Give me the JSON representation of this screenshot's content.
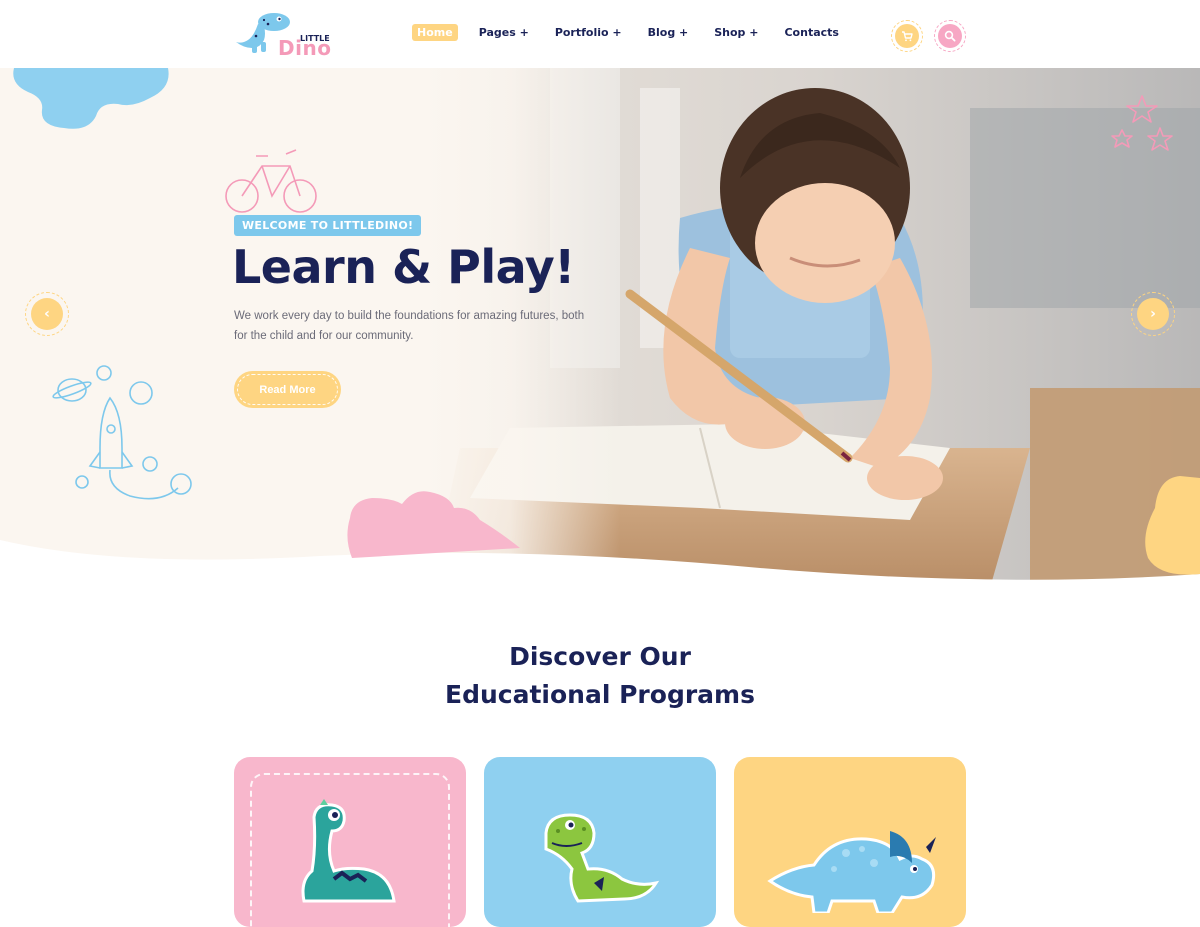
{
  "brand": {
    "logo_small": "LITTLE",
    "logo_big": "Dino"
  },
  "nav": {
    "items": [
      {
        "label": "Home",
        "active": true
      },
      {
        "label": "Pages +"
      },
      {
        "label": "Portfolio +"
      },
      {
        "label": "Blog +"
      },
      {
        "label": "Shop +"
      },
      {
        "label": "Contacts"
      }
    ],
    "cart_icon": "cart-icon",
    "search_icon": "search-icon"
  },
  "hero": {
    "badge": "WELCOME TO LITTLEDINO!",
    "title": "Learn & Play!",
    "description": "We work every day to build the foundations for amazing futures, both for the child and for our community.",
    "cta_label": "Read More",
    "prev_arrow": "‹",
    "next_arrow": "›"
  },
  "programs": {
    "title_line1": "Discover Our",
    "title_line2": "Educational Programs",
    "cards": [
      {
        "color": "#f8b7cc",
        "icon": "long-neck-dino-icon"
      },
      {
        "color": "#8fd0f0",
        "icon": "trex-dino-icon"
      },
      {
        "color": "#fed582",
        "icon": "triceratops-icon"
      }
    ]
  },
  "colors": {
    "navy": "#1a2257",
    "yellow": "#fed582",
    "pink": "#f7a7c4",
    "blue": "#7dc8ec"
  }
}
